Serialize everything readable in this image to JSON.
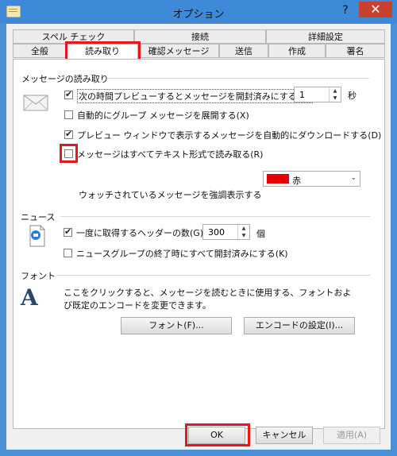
{
  "window": {
    "title": "オプション",
    "help": "?",
    "close": "✕"
  },
  "tabs_row1": [
    "スペル チェック",
    "接続",
    "詳細設定"
  ],
  "tabs_row2": [
    "全般",
    "読み取り",
    "確認メッセージ",
    "送信",
    "作成",
    "署名"
  ],
  "reading": {
    "section": "メッセージの読み取り",
    "opt1": "次の時間プレビューするとメッセージを開封済みにする(M)",
    "opt1_value": "1",
    "opt1_unit": "秒",
    "opt2": "自動的にグループ メッセージを展開する(X)",
    "opt3": "プレビュー ウィンドウで表示するメッセージを自動的にダウンロードする(D)",
    "opt4": "メッセージはすべてテキスト形式で読み取る(R)",
    "highlight_label": "ウォッチされているメッセージを強調表示する",
    "highlight_color_name": "赤",
    "highlight_color": "#e40000"
  },
  "news": {
    "section": "ニュース",
    "opt1": "一度に取得するヘッダーの数(G)",
    "opt1_value": "300",
    "opt1_unit": "個",
    "opt2": "ニュースグループの終了時にすべて開封済みにする(K)"
  },
  "fonts": {
    "section": "フォント",
    "desc1": "ここをクリックすると、メッセージを読むときに使用する、フォントおよ",
    "desc2": "び既定のエンコードを変更できます。",
    "fonts_button": "フォント(F)...",
    "encoding_button": "エンコードの設定(I)..."
  },
  "buttons": {
    "ok": "OK",
    "cancel": "キャンセル",
    "apply": "適用(A)"
  }
}
